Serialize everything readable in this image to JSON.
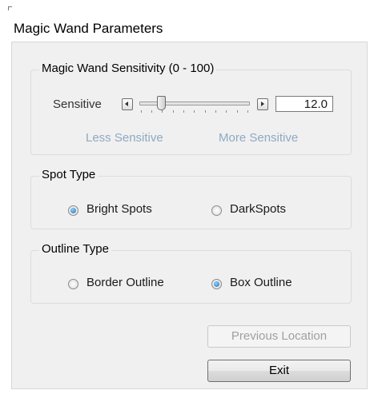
{
  "window": {
    "title": "Magic Wand Parameters"
  },
  "sensitivity": {
    "group_title": "Magic Wand Sensitivity (0 - 100)",
    "slider_label": "Sensitive",
    "value": "12.0",
    "slider_level": 12,
    "left_caption": "Less Sensitive",
    "right_caption": "More Sensitive"
  },
  "spot_type": {
    "group_title": "Spot Type",
    "options": [
      {
        "label": "Bright Spots",
        "checked": true
      },
      {
        "label": "DarkSpots",
        "checked": false
      }
    ]
  },
  "outline_type": {
    "group_title": "Outline Type",
    "options": [
      {
        "label": "Border Outline",
        "checked": false
      },
      {
        "label": "Box Outline",
        "checked": true
      }
    ]
  },
  "buttons": {
    "previous_location": "Previous Location",
    "exit": "Exit"
  }
}
